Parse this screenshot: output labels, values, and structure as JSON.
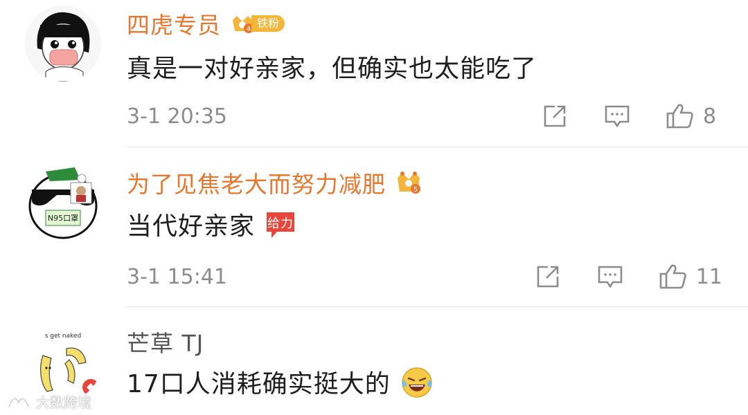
{
  "comments": [
    {
      "username": "四虎专员",
      "badge": {
        "level": "4",
        "label": "铁粉"
      },
      "text": "真是一对好亲家，但确实也太能吃了",
      "time": "3-1 20:35",
      "likes": "8",
      "avatar_icon": "masked-cartoon-girl-avatar"
    },
    {
      "username": "为了见焦老大而努力减肥",
      "badge": {
        "level": "5"
      },
      "text": "当代好亲家",
      "emoji": "给力",
      "time": "3-1 15:41",
      "likes": "11",
      "avatar_icon": "sunglasses-cartoon-avatar",
      "avatar_text": "N95口罩"
    },
    {
      "username": "芒草 TJ",
      "text": "17口人消耗确实挺大的",
      "emoji_icon": "laughing-tears-emoji",
      "avatar_icon": "banana-cartoon-avatar",
      "avatar_text": "s get naked"
    }
  ],
  "watermark": {
    "text": "大数跨境"
  },
  "colors": {
    "username": "#e8772e",
    "muted": "#8c8c8c",
    "text": "#1e1e1e",
    "badge": "#f3b63a",
    "divider": "#e6e6e6"
  }
}
